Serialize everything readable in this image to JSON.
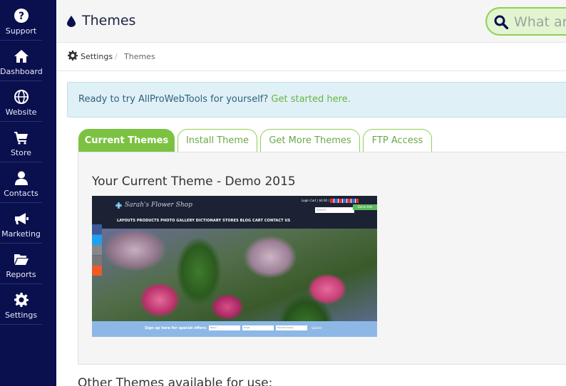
{
  "sidebar": {
    "items": [
      {
        "label": "Support",
        "icon": "question-circle-icon"
      },
      {
        "label": "Dashboard",
        "icon": "home-icon"
      },
      {
        "label": "Website",
        "icon": "globe-icon"
      },
      {
        "label": "Store",
        "icon": "cart-icon"
      },
      {
        "label": "Contacts",
        "icon": "user-icon"
      },
      {
        "label": "Marketing",
        "icon": "bullhorn-icon"
      },
      {
        "label": "Reports",
        "icon": "folder-open-icon"
      },
      {
        "label": "Settings",
        "icon": "gear-icon"
      }
    ]
  },
  "header": {
    "title": "Themes",
    "search_placeholder": "What ar"
  },
  "breadcrumb": {
    "root": "Settings",
    "separator": "/",
    "current": "Themes"
  },
  "alert": {
    "text": "Ready to try AllProWebTools for yourself? ",
    "link": "Get started here."
  },
  "tabs": [
    {
      "label": "Current Themes",
      "active": true
    },
    {
      "label": "Install Theme",
      "active": false
    },
    {
      "label": "Get More Themes",
      "active": false
    },
    {
      "label": "FTP Access",
      "active": false
    }
  ],
  "current_theme": {
    "heading": "Your Current Theme - Demo 2015",
    "preview": {
      "logo": "Sarah's Flower Shop",
      "nav": "LAYOUTS   PRODUCTS   PHOTO GALLERY   DICTIONARY   STORES   BLOG   CART   CONTACT US",
      "login": "Login    Cart ( $0.00 )",
      "search": "Search",
      "demo_badge": "Demo Info",
      "signup": "Sign up here for special offers:",
      "field_name": "Name",
      "field_email": "Email",
      "field_flower": "Favorite Flower",
      "submit": "Submit"
    }
  },
  "other_themes_heading": "Other Themes available for use:",
  "colors": {
    "sidebar_bg": "#0a0f4e",
    "accent_green": "#7cc242",
    "alert_bg": "#dff0f7",
    "link_green": "#6bb344"
  }
}
